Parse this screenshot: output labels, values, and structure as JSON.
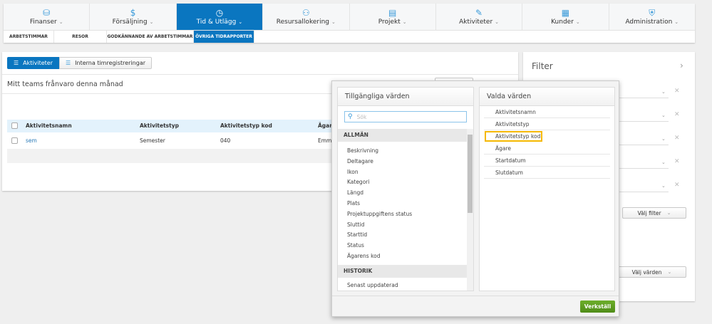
{
  "nav": {
    "items": [
      {
        "label": "Finanser",
        "icon": "database-icon"
      },
      {
        "label": "Försäljning",
        "icon": "dollar-icon"
      },
      {
        "label": "Tid & Utlägg",
        "icon": "clock-icon",
        "active": true
      },
      {
        "label": "Resursallokering",
        "icon": "users-icon"
      },
      {
        "label": "Projekt",
        "icon": "folder-icon"
      },
      {
        "label": "Aktiviteter",
        "icon": "pencil-icon"
      },
      {
        "label": "Kunder",
        "icon": "building-icon"
      },
      {
        "label": "Administration",
        "icon": "shield-icon"
      }
    ],
    "subitems": [
      "ARBETSTIMMAR",
      "RESOR",
      "GODKÄNNANDE AV ARBETSTIMMAR",
      "ÖVRIGA TIDRAPPORTER"
    ]
  },
  "main": {
    "tabs": [
      "Aktiviteter",
      "Interna timregistreringar"
    ],
    "title": "Mitt teams frånvaro denna månad",
    "table": {
      "headers": [
        "Aktivitetsnamn",
        "Aktivitetstyp",
        "Aktivitetstyp kod",
        "Ägare"
      ],
      "rows": [
        [
          "sem",
          "Semester",
          "040",
          "Emma"
        ]
      ]
    }
  },
  "filter": {
    "title": "Filter",
    "choose_filter": "Välj filter",
    "choose_values": "Välj värden"
  },
  "popup": {
    "available_title": "Tillgängliga värden",
    "search_placeholder": "Sök",
    "groups": [
      {
        "name": "ALLMÄN",
        "items": [
          "Beskrivning",
          "Deltagare",
          "Ikon",
          "Kategori",
          "Längd",
          "Plats",
          "Projektuppgiftens status",
          "Sluttid",
          "Starttid",
          "Status",
          "Ägarens kod"
        ]
      },
      {
        "name": "HISTORIK",
        "items": [
          "Senast uppdaterad"
        ]
      }
    ],
    "selected_title": "Valda värden",
    "selected": [
      "Aktivitetsnamn",
      "Aktivitetstyp",
      "Aktivitetstyp kod",
      "Ägare",
      "Startdatum",
      "Slutdatum"
    ],
    "apply": "Verkställ"
  },
  "colors": {
    "primary": "#0a76c0",
    "apply": "#5a9a1e",
    "highlight": "#f5b800"
  }
}
